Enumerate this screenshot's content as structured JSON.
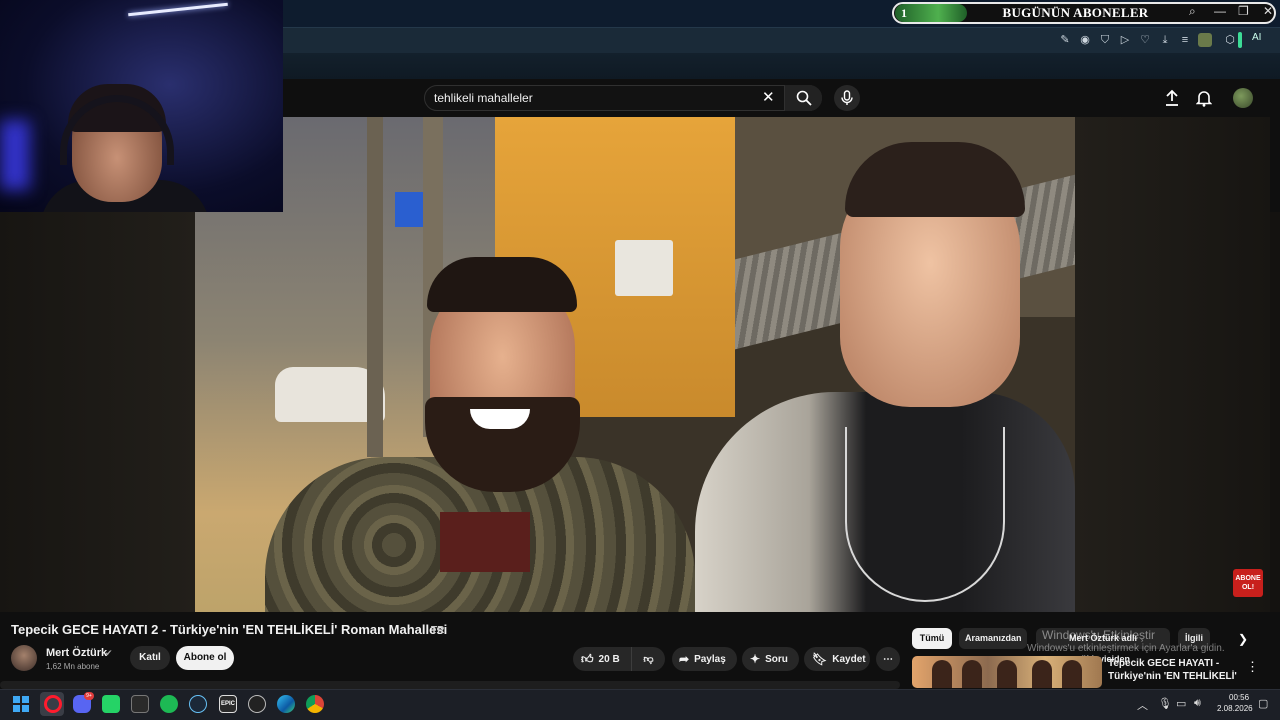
{
  "overlay": {
    "subscribers_rank": "1",
    "subscribers_title": "BUGÜNÜN ABONELER"
  },
  "window_controls": {
    "search": "⌕",
    "minimize": "—",
    "restore": "❐",
    "close": "✕"
  },
  "toolbar": {
    "ai_label": "AI"
  },
  "search": {
    "query": "tehlikeli mahalleler",
    "clear_symbol": "✕"
  },
  "video": {
    "title": "Tepecik GECE HAYATI 2 - Türkiye'nin 'EN TEHLİKELİ' Roman Mahallesi",
    "lang_badge": "TR",
    "watermark_logo": "ABONE OL!"
  },
  "channel": {
    "name": "Mert Öztürk",
    "subscribers": "1,62 Mn abone",
    "join_label": "Katıl",
    "subscribe_label": "Abone ol"
  },
  "actions": {
    "likes": "20 B",
    "share": "Paylaş",
    "ask": "Soru",
    "save": "Kaydet",
    "more": "⋯"
  },
  "chips": [
    "Tümü",
    "Aramanızdan",
    "Mert Öztürk adlı yükleyiciden",
    "İlgili"
  ],
  "recommendation": {
    "title": "Tepecik GECE HAYATI - Türkiye'nin 'EN TEHLİKELİ' ..."
  },
  "windows_watermark": {
    "line1": "Windows'u Etkinleştir",
    "line2": "Windows'u etkinleştirmek için Ayarlar'a gidin."
  },
  "taskbar": {
    "discord_badge": "9+",
    "epic_label": "EPIC",
    "time": "00:56",
    "date": "2.08.2026"
  }
}
